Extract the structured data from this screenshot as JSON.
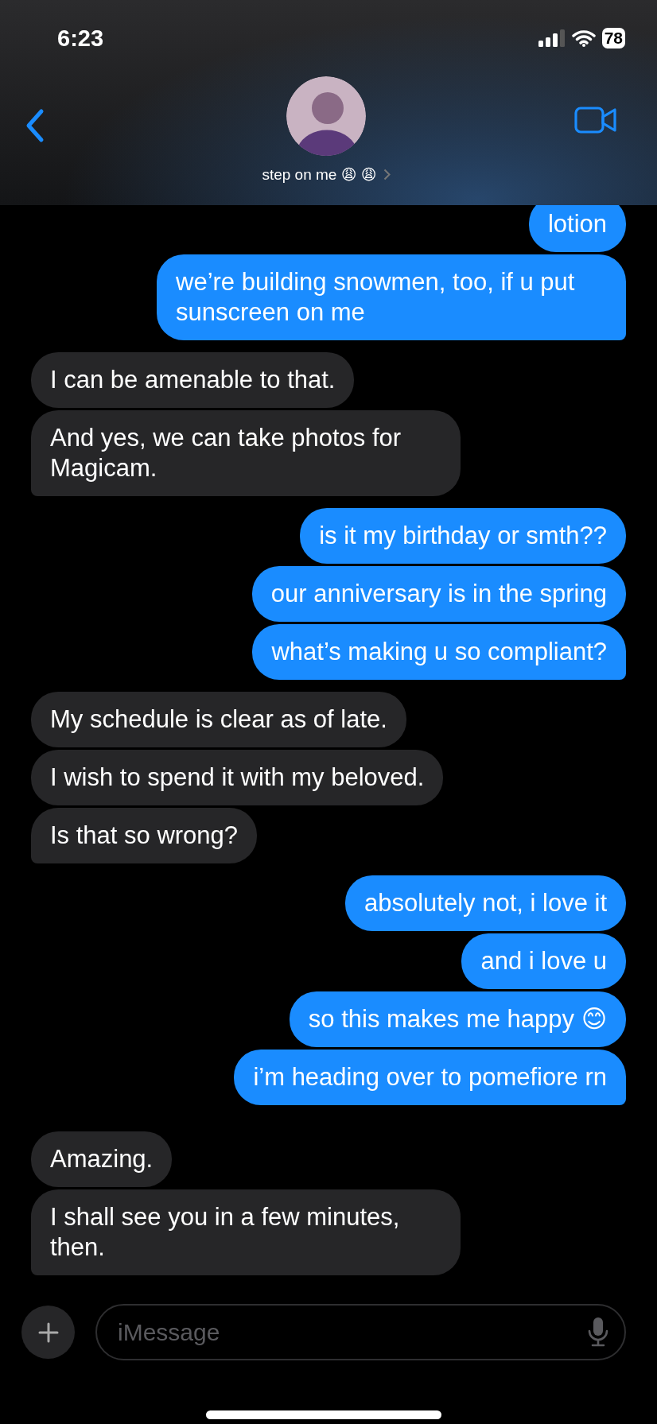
{
  "status_bar": {
    "time": "6:23",
    "battery": "78"
  },
  "header": {
    "contact_name": "step on me 😩 😩"
  },
  "groups": [
    {
      "kind": "sent",
      "messages": [
        "lotion",
        "we’re building snowmen, too, if u put sunscreen on me"
      ]
    },
    {
      "kind": "received",
      "messages": [
        "I can be amenable to that.",
        "And yes, we can take photos for Magicam."
      ]
    },
    {
      "kind": "sent",
      "messages": [
        "is it my birthday or smth??",
        "our anniversary is in the spring",
        "what’s making u so compliant?"
      ]
    },
    {
      "kind": "received",
      "messages": [
        "My schedule is clear as of late.",
        "I wish to spend it with my beloved.",
        "Is that so wrong?"
      ]
    },
    {
      "kind": "sent",
      "messages": [
        "absolutely not, i love it",
        "and i love u",
        "so this makes me happy 😊",
        "i’m heading over to pomefiore rn"
      ]
    },
    {
      "kind": "received",
      "messages": [
        "Amazing.",
        "I shall see you in a few minutes, then."
      ]
    }
  ],
  "composer": {
    "placeholder": "iMessage"
  }
}
